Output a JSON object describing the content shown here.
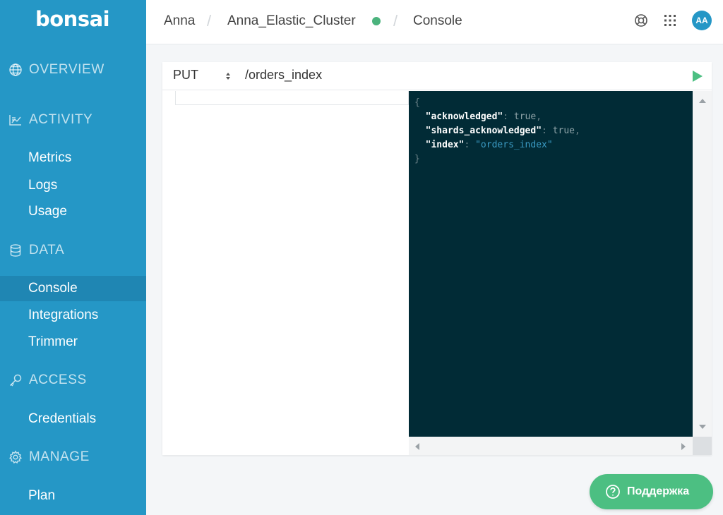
{
  "sidebar": {
    "logo": "bonsai",
    "sections": {
      "overview": "OVERVIEW",
      "activity": "ACTIVITY",
      "data": "DATA",
      "access": "ACCESS",
      "manage": "MANAGE"
    },
    "items": {
      "metrics": "Metrics",
      "logs": "Logs",
      "usage": "Usage",
      "console": "Console",
      "integrations": "Integrations",
      "trimmer": "Trimmer",
      "credentials": "Credentials",
      "plan": "Plan"
    },
    "active_item": "Console"
  },
  "header": {
    "breadcrumb": [
      "Anna",
      "Anna_Elastic_Cluster",
      "Console"
    ],
    "cluster_status_color": "#4bb37d",
    "avatar_initials": "AA",
    "icons": [
      "lifebuoy-icon",
      "apps-grid-icon"
    ]
  },
  "console": {
    "method": "PUT",
    "path": "/orders_index",
    "response": {
      "open_brace": "{",
      "close_brace": "}",
      "lines": [
        {
          "key": "\"acknowledged\"",
          "sep": ": ",
          "value": "true",
          "trail": ","
        },
        {
          "key": "\"shards_acknowledged\"",
          "sep": ": ",
          "value": "true",
          "trail": ","
        },
        {
          "key": "\"index\"",
          "sep": ": ",
          "value": "\"orders_index\"",
          "trail": ""
        }
      ]
    }
  },
  "support": {
    "label": "Поддержка"
  },
  "colors": {
    "sidebar": "#2597c6",
    "sidebar_active": "#1f86b3",
    "output_bg": "#012b36",
    "accent_green": "#4cbf82"
  }
}
